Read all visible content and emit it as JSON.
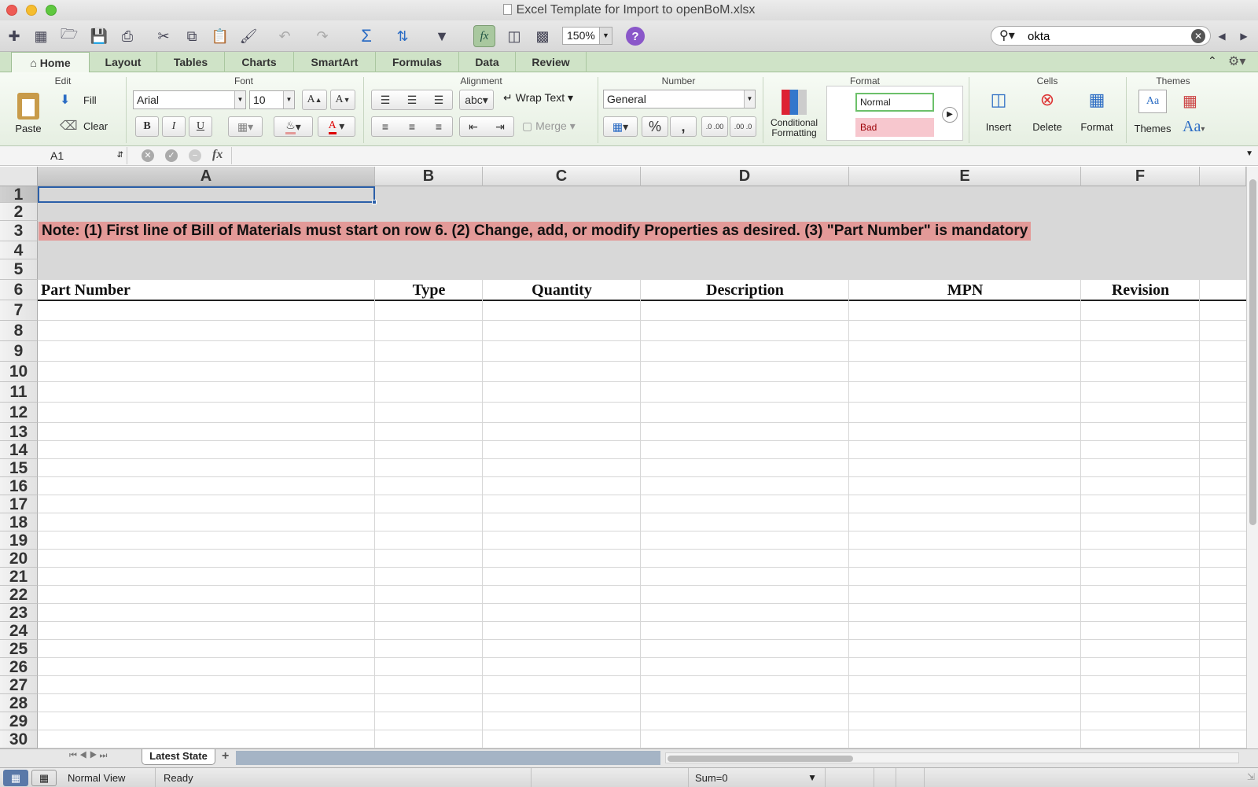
{
  "window": {
    "title": "Excel Template for Import to openBoM.xlsx"
  },
  "toolbar": {
    "zoom": "150%",
    "search_value": "okta"
  },
  "tabs": [
    "Home",
    "Layout",
    "Tables",
    "Charts",
    "SmartArt",
    "Formulas",
    "Data",
    "Review"
  ],
  "ribbon": {
    "edit": {
      "title": "Edit",
      "paste": "Paste",
      "fill": "Fill",
      "clear": "Clear"
    },
    "font": {
      "title": "Font",
      "font_name": "Arial",
      "font_size": "10",
      "bold": "B",
      "italic": "I",
      "underline": "U",
      "grow": "A",
      "shrink": "A",
      "color": "A"
    },
    "alignment": {
      "title": "Alignment",
      "abc": "abc",
      "wrap_text": "Wrap Text",
      "merge": "Merge"
    },
    "number": {
      "title": "Number",
      "format": "General",
      "percent": "%",
      "comma": ",",
      "inc_decimal": ".0 .00",
      "dec_decimal": ".00 .0"
    },
    "format": {
      "title": "Format",
      "conditional": "Conditional Formatting",
      "normal_style": "Normal",
      "bad_style": "Bad"
    },
    "cells": {
      "title": "Cells",
      "insert": "Insert",
      "delete": "Delete",
      "format": "Format"
    },
    "themes": {
      "title": "Themes",
      "themes": "Themes",
      "theme_sample": "Aa",
      "font_aa": "Aa"
    }
  },
  "formula_bar": {
    "name_box": "A1",
    "fx": "fx",
    "formula": ""
  },
  "sheet": {
    "columns": [
      "A",
      "B",
      "C",
      "D",
      "E",
      "F"
    ],
    "rows": [
      "1",
      "2",
      "3",
      "4",
      "5",
      "6",
      "7",
      "8",
      "9",
      "10",
      "11",
      "12",
      "13",
      "14",
      "15",
      "16",
      "17",
      "18",
      "19",
      "20",
      "21",
      "22",
      "23",
      "24",
      "25",
      "26",
      "27",
      "28",
      "29",
      "30"
    ],
    "note": "Note: (1) First line of Bill of Materials must start on row 6.   (2) Change, add, or modify Properties as desired.   (3) \"Part Number\" is mandatory",
    "headers": [
      "Part Number",
      "Type",
      "Quantity",
      "Description",
      "MPN",
      "Revision"
    ],
    "note_color": "#e39a98",
    "grey_band_color": "#d8d8d8"
  },
  "sheet_tabs": {
    "active": "Latest State",
    "add": "+"
  },
  "status": {
    "view": "Normal View",
    "state": "Ready",
    "sum": "Sum=0"
  }
}
